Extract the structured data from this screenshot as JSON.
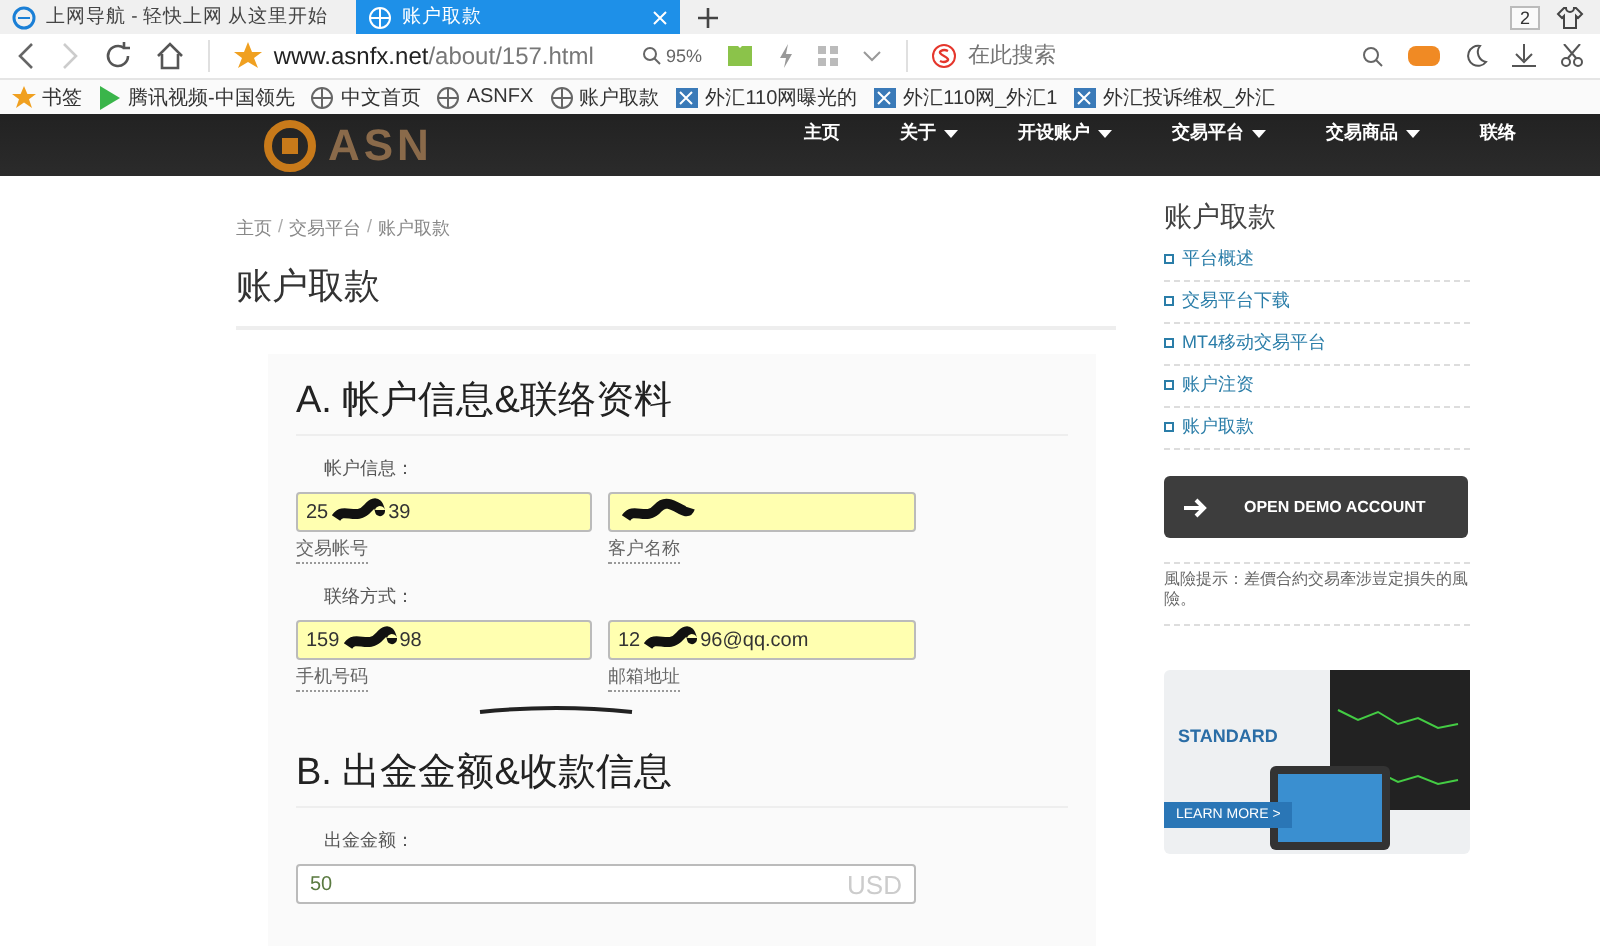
{
  "browser": {
    "tabs": [
      {
        "title": "上网导航 - 轻快上网 从这里开始",
        "selected": false
      },
      {
        "title": "账户取款",
        "selected": true
      }
    ],
    "tab_count": "2",
    "url_host": "www.asnfx.net",
    "url_path": "/about/157.html",
    "zoom": "95%",
    "search": {
      "placeholder": "在此搜索"
    },
    "bookmarks": [
      {
        "label": "书签",
        "kind": "star"
      },
      {
        "label": "腾讯视频-中国领先",
        "kind": "play"
      },
      {
        "label": "中文首页",
        "kind": "globe"
      },
      {
        "label": "ASNFX",
        "kind": "globe"
      },
      {
        "label": "账户取款",
        "kind": "globe"
      },
      {
        "label": "外汇110网曝光的",
        "kind": "fx"
      },
      {
        "label": "外汇110网_外汇1",
        "kind": "fx"
      },
      {
        "label": "外汇投诉维权_外汇",
        "kind": "fx"
      }
    ]
  },
  "site": {
    "logo_text": "ASN",
    "nav": [
      {
        "label": "主页",
        "dropdown": false
      },
      {
        "label": "关于",
        "dropdown": true
      },
      {
        "label": "开设账户",
        "dropdown": true
      },
      {
        "label": "交易平台",
        "dropdown": true
      },
      {
        "label": "交易商品",
        "dropdown": true
      },
      {
        "label": "联络",
        "dropdown": false
      }
    ]
  },
  "breadcrumb": {
    "separator": "/",
    "items": [
      "主页",
      "交易平台",
      "账户取款"
    ]
  },
  "page_title": "账户取款",
  "section_a": {
    "heading": "A. 帐户信息&联络资料",
    "groups": [
      {
        "label": "帐户信息：",
        "fields": [
          {
            "caption": "交易帐号",
            "value_start": "25",
            "value_end": "39",
            "redacted": true
          },
          {
            "caption": "客户名称",
            "redacted": true
          }
        ]
      },
      {
        "label": "联络方式：",
        "fields": [
          {
            "caption": "手机号码",
            "value_start": "159",
            "value_end": "98",
            "redacted": true
          },
          {
            "caption": "邮箱地址",
            "value_start": "12",
            "value_end": "96@qq.com",
            "redacted": true
          }
        ]
      }
    ]
  },
  "section_b": {
    "heading": "B. 出金金额&收款信息",
    "label": "出金金额：",
    "amount": "50",
    "currency": "USD"
  },
  "sidebar": {
    "title": "账户取款",
    "links": [
      "平台概述",
      "交易平台下载",
      "MT4移动交易平台",
      "账户注资",
      "账户取款"
    ],
    "demo_button": "OPEN DEMO ACCOUNT",
    "risk_note": "風險提示：差價合約交易牽涉豈定損失的風險。",
    "banner": {
      "title": "STANDARD",
      "button": "LEARN MORE >"
    }
  }
}
